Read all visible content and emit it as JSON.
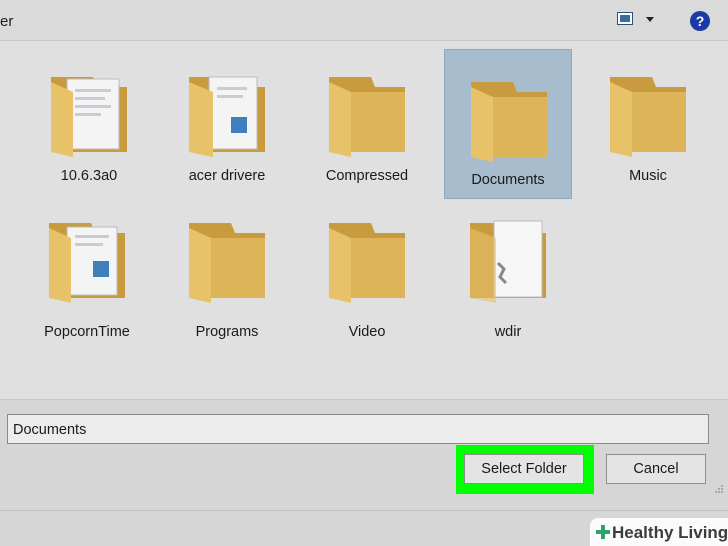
{
  "window": {
    "title_fragment": "er"
  },
  "toolbar": {
    "view_icon": "change-view-icon",
    "help_label": "?"
  },
  "items": [
    {
      "name": "10.6.3a0",
      "type": "folder-with-files"
    },
    {
      "name": "acer drivere",
      "type": "folder-with-files"
    },
    {
      "name": "Compressed",
      "type": "folder"
    },
    {
      "name": "Documents",
      "type": "folder",
      "selected": true
    },
    {
      "name": "Music",
      "type": "folder"
    },
    {
      "name": "PopcornTime",
      "type": "folder-with-files"
    },
    {
      "name": "Programs",
      "type": "folder"
    },
    {
      "name": "Video",
      "type": "folder"
    },
    {
      "name": "wdir",
      "type": "folder-with-files"
    }
  ],
  "folder_name_field": {
    "value": "Documents"
  },
  "buttons": {
    "select_folder": "Select Folder",
    "cancel": "Cancel"
  },
  "watermark": {
    "text": "Healthy Living"
  },
  "colors": {
    "folder": "#e8c268",
    "selection": "#a7bccd",
    "highlight": "#00ff00",
    "help": "#1a3aa8",
    "watermark_cross": "#2ea36b"
  }
}
